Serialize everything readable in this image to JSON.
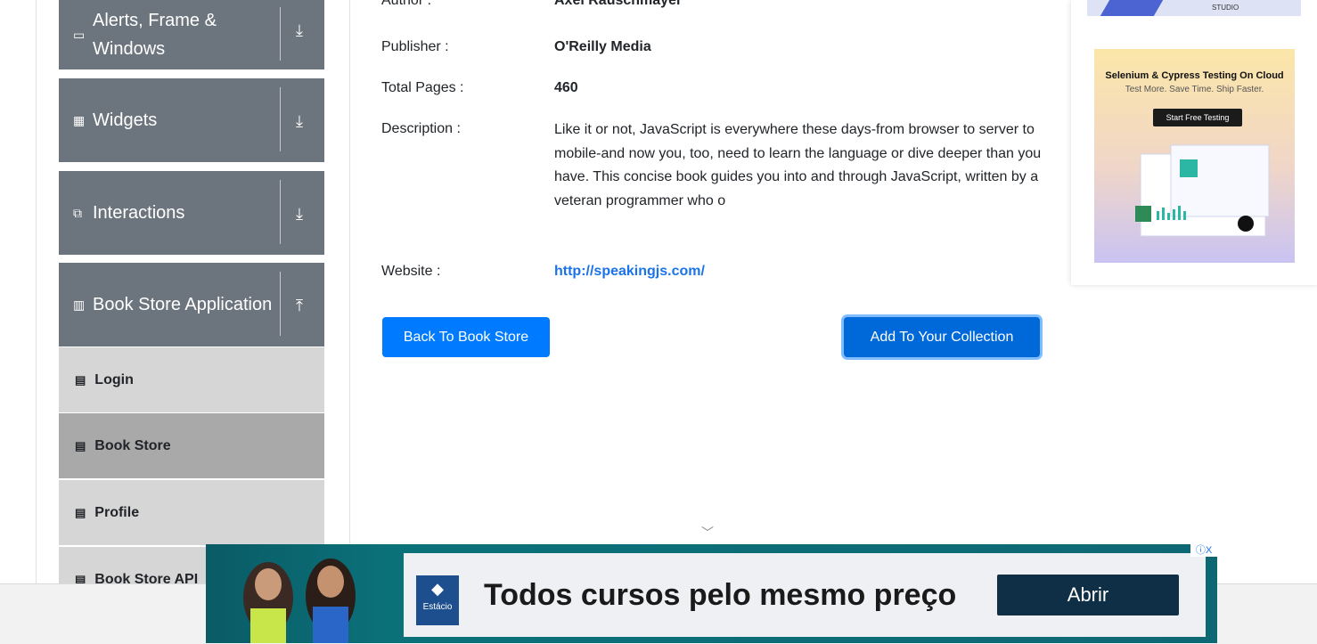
{
  "sidebar": {
    "groups": [
      {
        "label": "Alerts, Frame & Windows",
        "icon": "window-icon",
        "arrow": "⌄"
      },
      {
        "label": "Widgets",
        "icon": "widgets-icon",
        "arrow": "⌄"
      },
      {
        "label": "Interactions",
        "icon": "interactions-icon",
        "arrow": "⌄"
      },
      {
        "label": "Book Store Application",
        "icon": "library-icon",
        "arrow": "⌃"
      }
    ],
    "items": [
      {
        "label": "Login"
      },
      {
        "label": "Book Store"
      },
      {
        "label": "Profile"
      },
      {
        "label": "Book Store API"
      }
    ]
  },
  "book": {
    "author_label": "Author :",
    "author_value": "Axel Rauschmayer",
    "publisher_label": "Publisher :",
    "publisher_value": "O'Reilly Media",
    "pages_label": "Total Pages :",
    "pages_value": "460",
    "description_label": "Description :",
    "description_value": "Like it or not, JavaScript is everywhere these days-from browser to server to mobile-and now you, too, need to learn the language or dive deeper than you have. This concise book guides you into and through JavaScript, written by a veteran programmer who o",
    "website_label": "Website :",
    "website_value": "http://speakingjs.com/"
  },
  "buttons": {
    "back": "Back To Book Store",
    "add": "Add To Your Collection"
  },
  "side_ad": {
    "studio": "STUDIO",
    "title": "Selenium & Cypress Testing On Cloud",
    "subtitle": "Test More. Save Time. Ship Faster.",
    "cta": "Start Free Testing"
  },
  "bottom_ad": {
    "logo": "Estácio",
    "headline": "Todos cursos pelo mesmo preço",
    "cta": "Abrir",
    "adchoices": "ⓘX"
  },
  "colors": {
    "primary": "#007bff",
    "sidebar_group": "#6c757d",
    "menu_item": "#d6d6d6",
    "menu_item_active": "#a9a9a9",
    "link": "#1a73e8"
  }
}
